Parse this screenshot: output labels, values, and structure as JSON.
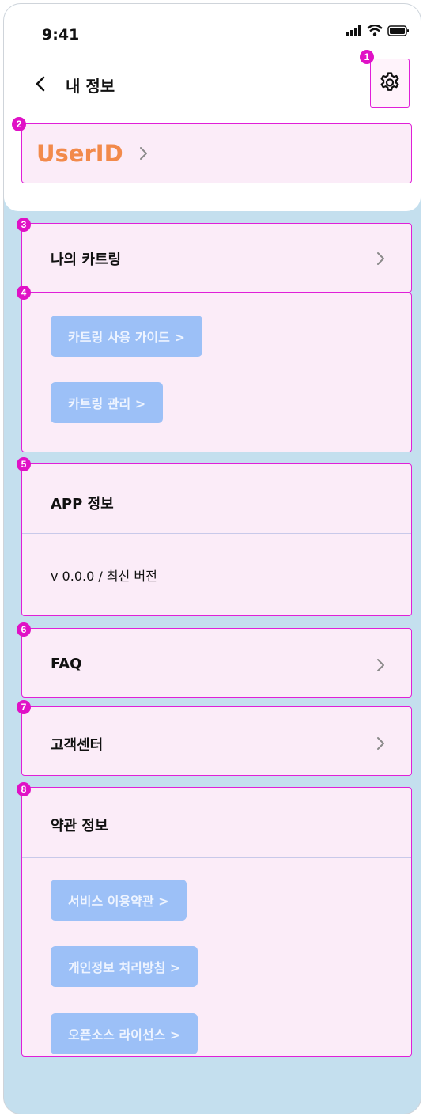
{
  "status_bar": {
    "time": "9:41"
  },
  "header": {
    "title": "내 정보"
  },
  "user": {
    "id": "UserID"
  },
  "markers": [
    "1",
    "2",
    "3",
    "4",
    "5",
    "6",
    "7",
    "8"
  ],
  "my_cartridge": {
    "label": "나의 카트링"
  },
  "cartridge_links": [
    {
      "label": "카트링 사용 가이드 >"
    },
    {
      "label": "카트링 관리 >"
    }
  ],
  "app_info": {
    "title": "APP 정보",
    "version_text": "v 0.0.0 / 최신 버전"
  },
  "faq": {
    "label": "FAQ"
  },
  "support": {
    "label": "고객센터"
  },
  "terms": {
    "title": "약관 정보",
    "links": [
      {
        "label": "서비스 이용약관 >"
      },
      {
        "label": "개인정보 처리방침 >"
      },
      {
        "label": "오픈소스 라이선스 >"
      }
    ]
  },
  "colors": {
    "highlight_border": "#e01fd8",
    "highlight_fill": "#fbecf8",
    "userid": "#f28a4b",
    "pill": "#9cc0f7",
    "background": "#c4dfee"
  }
}
